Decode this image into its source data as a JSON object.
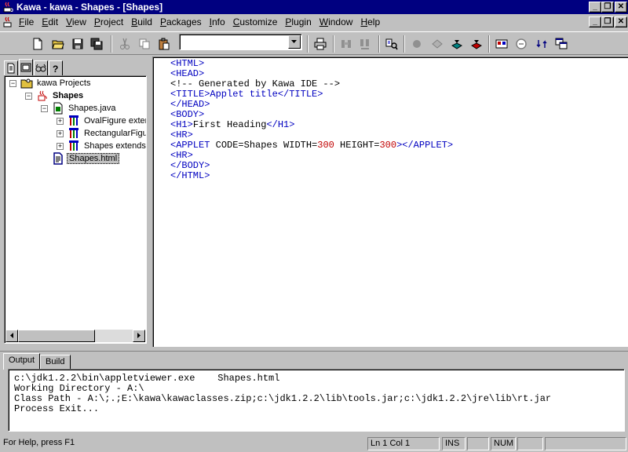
{
  "window": {
    "title": "Kawa - kawa - Shapes - [Shapes]",
    "min_glyph": "_",
    "max_glyph": "❐",
    "close_glyph": "✕"
  },
  "menu": {
    "items": [
      "File",
      "Edit",
      "View",
      "Project",
      "Build",
      "Packages",
      "Info",
      "Customize",
      "Plugin",
      "Window",
      "Help"
    ]
  },
  "toolbar": {
    "combo_value": ""
  },
  "left_panel": {
    "tree": {
      "root": "kawa Projects",
      "project": "Shapes",
      "java_file": "Shapes.java",
      "classes": [
        "OvalFigure exter",
        "RectangularFigu",
        "Shapes extends"
      ],
      "html_file": "Shapes.html"
    }
  },
  "editor": {
    "lines": [
      {
        "parts": [
          {
            "t": "<HTML>",
            "c": "t"
          }
        ]
      },
      {
        "parts": [
          {
            "t": "<HEAD>",
            "c": "t"
          }
        ]
      },
      {
        "parts": [
          {
            "t": "<!-- Generated by Kawa IDE -->",
            "c": ""
          }
        ]
      },
      {
        "parts": [
          {
            "t": "<TITLE>Applet title</TITLE>",
            "c": "t"
          }
        ]
      },
      {
        "parts": [
          {
            "t": "</HEAD>",
            "c": "t"
          }
        ]
      },
      {
        "parts": [
          {
            "t": "<BODY>",
            "c": "t"
          }
        ]
      },
      {
        "parts": [
          {
            "t": "<H1>",
            "c": "t"
          },
          {
            "t": "First Heading",
            "c": ""
          },
          {
            "t": "</H1>",
            "c": "t"
          }
        ]
      },
      {
        "parts": [
          {
            "t": "<HR>",
            "c": "t"
          }
        ]
      },
      {
        "parts": [
          {
            "t": "<APPLET",
            "c": "t"
          },
          {
            "t": " CODE=Shapes WIDTH=",
            "c": ""
          },
          {
            "t": "300",
            "c": "n"
          },
          {
            "t": " HEIGHT=",
            "c": ""
          },
          {
            "t": "300",
            "c": "n"
          },
          {
            "t": "></APPLET>",
            "c": "t"
          }
        ]
      },
      {
        "parts": [
          {
            "t": "<HR>",
            "c": "t"
          }
        ]
      },
      {
        "parts": [
          {
            "t": "</BODY>",
            "c": "t"
          }
        ]
      },
      {
        "parts": [
          {
            "t": "</HTML>",
            "c": "t"
          }
        ]
      }
    ]
  },
  "bottom": {
    "tabs": [
      "Output",
      "Build"
    ],
    "output_lines": [
      "c:\\jdk1.2.2\\bin\\appletviewer.exe    Shapes.html",
      "Working Directory - A:\\",
      "Class Path - A:\\;.;E:\\kawa\\kawaclasses.zip;c:\\jdk1.2.2\\lib\\tools.jar;c:\\jdk1.2.2\\jre\\lib\\rt.jar",
      "Process Exit..."
    ]
  },
  "status": {
    "help": "For Help, press F1",
    "position": "Ln 1 Col 1",
    "ins": "INS",
    "num": "NUM"
  }
}
